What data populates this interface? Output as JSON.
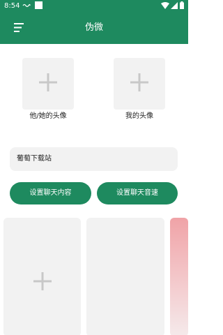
{
  "status_bar": {
    "time": "8:54",
    "icons": [
      "wifi-icon",
      "signal-icon",
      "battery-icon"
    ]
  },
  "app_bar": {
    "title": "伪微",
    "menu_icon": "menu-icon"
  },
  "avatars": {
    "other_label": "他/她的头像",
    "mine_label": "我的头像",
    "add_icon": "plus-icon"
  },
  "site": {
    "text": "葡萄下载站"
  },
  "buttons": {
    "chat_content": "设置聊天内容",
    "chat_sound": "设置聊天音速"
  },
  "colors": {
    "primary": "#1e8a5f",
    "tile": "#f2f2f2",
    "plus": "#c8c8c8"
  }
}
